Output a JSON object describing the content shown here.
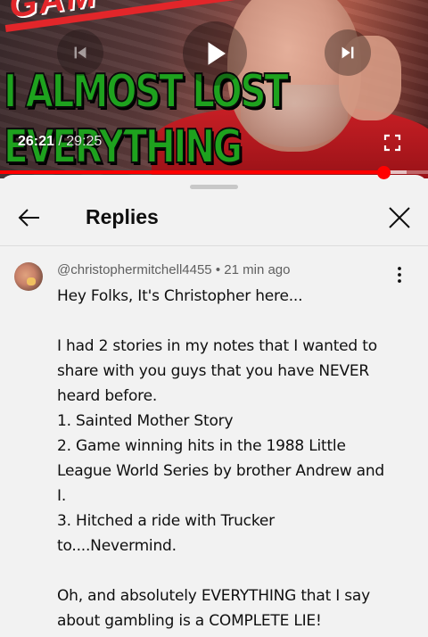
{
  "player": {
    "thumbnail_top_text": "GAM",
    "thumbnail_title_line1": "I ALMOST LOST",
    "thumbnail_title_line2": "EVERYTHING",
    "current_time": "26:21",
    "time_separator": "/",
    "duration": "29:25",
    "progress_fraction": 0.896,
    "buffered_fraction": 0.95,
    "progress_color": "#ff0000",
    "icons": {
      "previous": "skip-previous-icon",
      "play": "play-icon",
      "next": "skip-next-icon",
      "fullscreen": "fullscreen-icon"
    }
  },
  "sheet": {
    "title": "Replies",
    "back_icon": "arrow-back-icon",
    "close_icon": "close-icon"
  },
  "comment": {
    "author": "@christophermitchell4455",
    "dot": "•",
    "timestamp": "21 min ago",
    "menu_icon": "more-vert-icon",
    "lines": [
      "Hey Folks, It's Christopher here...",
      "",
      "I had 2 stories in my notes that I wanted to share with you guys that you have NEVER heard before.",
      "1. Sainted Mother Story",
      "2. Game winning hits in the 1988 Little League World Series by brother Andrew and I.",
      "3. Hitched a ride with Trucker to....Nevermind.",
      "",
      "Oh, and absolutely EVERYTHING that I say about gambling is a COMPLETE LIE!"
    ]
  }
}
